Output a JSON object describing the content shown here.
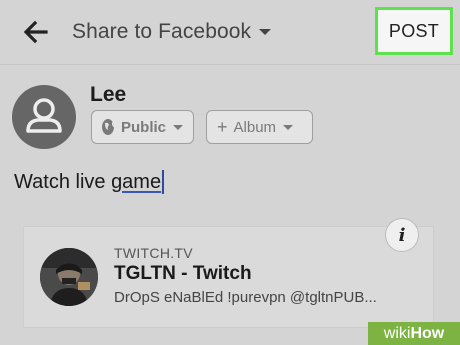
{
  "header": {
    "title": "Share to Facebook",
    "post_label": "POST"
  },
  "composer": {
    "user_name": "Lee",
    "audience_label": "Public",
    "album_label": "Album",
    "status_text_plain": "Watch live ",
    "status_text_underlined": "game"
  },
  "link_preview": {
    "domain": "TWITCH.TV",
    "title": "TGLTN - Twitch",
    "description": "DrOpS eNaBlEd !purevpn @tgltnPUB..."
  },
  "watermark": {
    "wiki": "wiki",
    "how": "How"
  },
  "colors": {
    "post_highlight": "#5fe04f",
    "caret": "#2b4c9c",
    "watermark_bg": "#7cb342"
  },
  "icons": [
    "back-arrow-icon",
    "chevron-down-icon",
    "avatar-placeholder-icon",
    "globe-icon",
    "plus-icon",
    "info-icon"
  ]
}
